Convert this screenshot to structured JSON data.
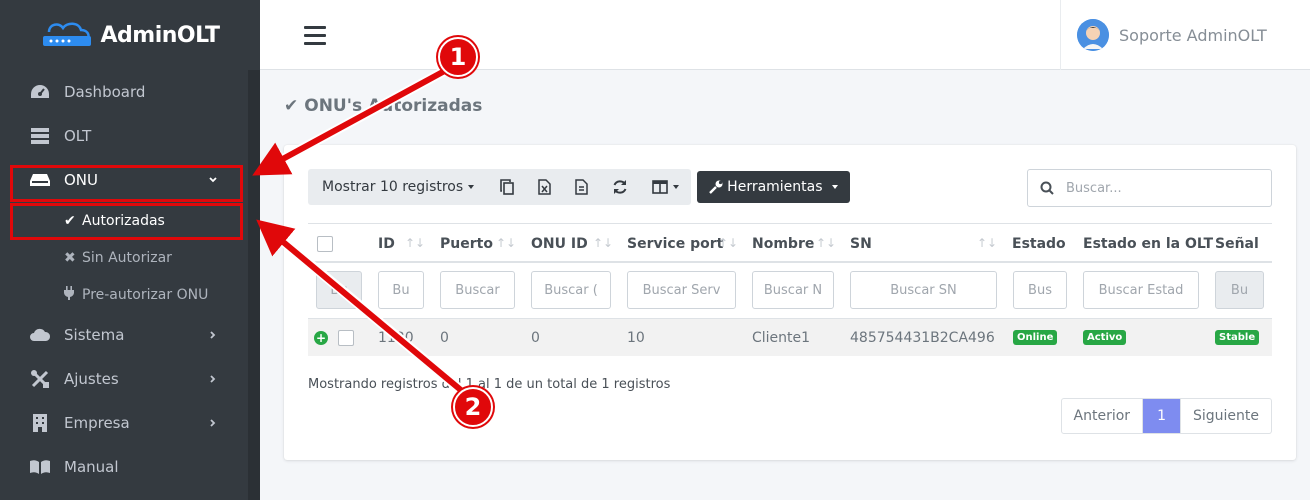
{
  "brand": {
    "name": "AdminOLT"
  },
  "sidebar": {
    "items": [
      {
        "label": "Dashboard",
        "icon": "dashboard-icon"
      },
      {
        "label": "OLT",
        "icon": "server-icon"
      },
      {
        "label": "ONU",
        "icon": "router-icon",
        "expanded": true
      },
      {
        "label": "Sistema",
        "icon": "cloud-icon"
      },
      {
        "label": "Ajustes",
        "icon": "tools-icon"
      },
      {
        "label": "Empresa",
        "icon": "building-icon"
      },
      {
        "label": "Manual",
        "icon": "book-icon"
      }
    ],
    "onu_sub": [
      {
        "label": "Autorizadas",
        "icon": "check-icon",
        "active": true
      },
      {
        "label": "Sin Autorizar",
        "icon": "times-icon"
      },
      {
        "label": "Pre-autorizar ONU",
        "icon": "plug-icon"
      }
    ]
  },
  "header": {
    "user_name": "Soporte AdminOLT"
  },
  "page": {
    "title": "ONU's Autorizadas"
  },
  "toolbar": {
    "show_label": "Mostrar 10 registros",
    "tools_label": "Herramientas",
    "icons": [
      "copy-icon",
      "excel-icon",
      "file-icon",
      "refresh-icon",
      "columns-icon"
    ]
  },
  "search": {
    "placeholder": "Buscar..."
  },
  "table": {
    "columns": [
      "ID",
      "Puerto",
      "ONU ID",
      "Service port",
      "Nombre",
      "SN",
      "Estado",
      "Estado en la OLT",
      "Señal"
    ],
    "filters": [
      "Bu",
      "Bu",
      "Buscar",
      "Buscar (",
      "Buscar Serv",
      "Buscar N",
      "Buscar SN",
      "Bus",
      "Buscar Estad",
      "Bu"
    ],
    "rows": [
      {
        "id": "1120",
        "puerto": "0",
        "onu_id": "0",
        "service_port": "10",
        "nombre": "Cliente1",
        "sn": "485754431B2CA496",
        "estado": "Online",
        "estado_olt": "Activo",
        "senal": "Stable"
      }
    ]
  },
  "footer": {
    "info": "Mostrando registros del 1 al 1 de un total de 1 registros",
    "prev": "Anterior",
    "page": "1",
    "next": "Siguiente"
  },
  "annotations": {
    "marker1": "1",
    "marker2": "2"
  },
  "colors": {
    "sidebar": "#343a40",
    "highlight": "#e0080a",
    "success": "#28a745",
    "pager_active": "#7e8cf0"
  }
}
